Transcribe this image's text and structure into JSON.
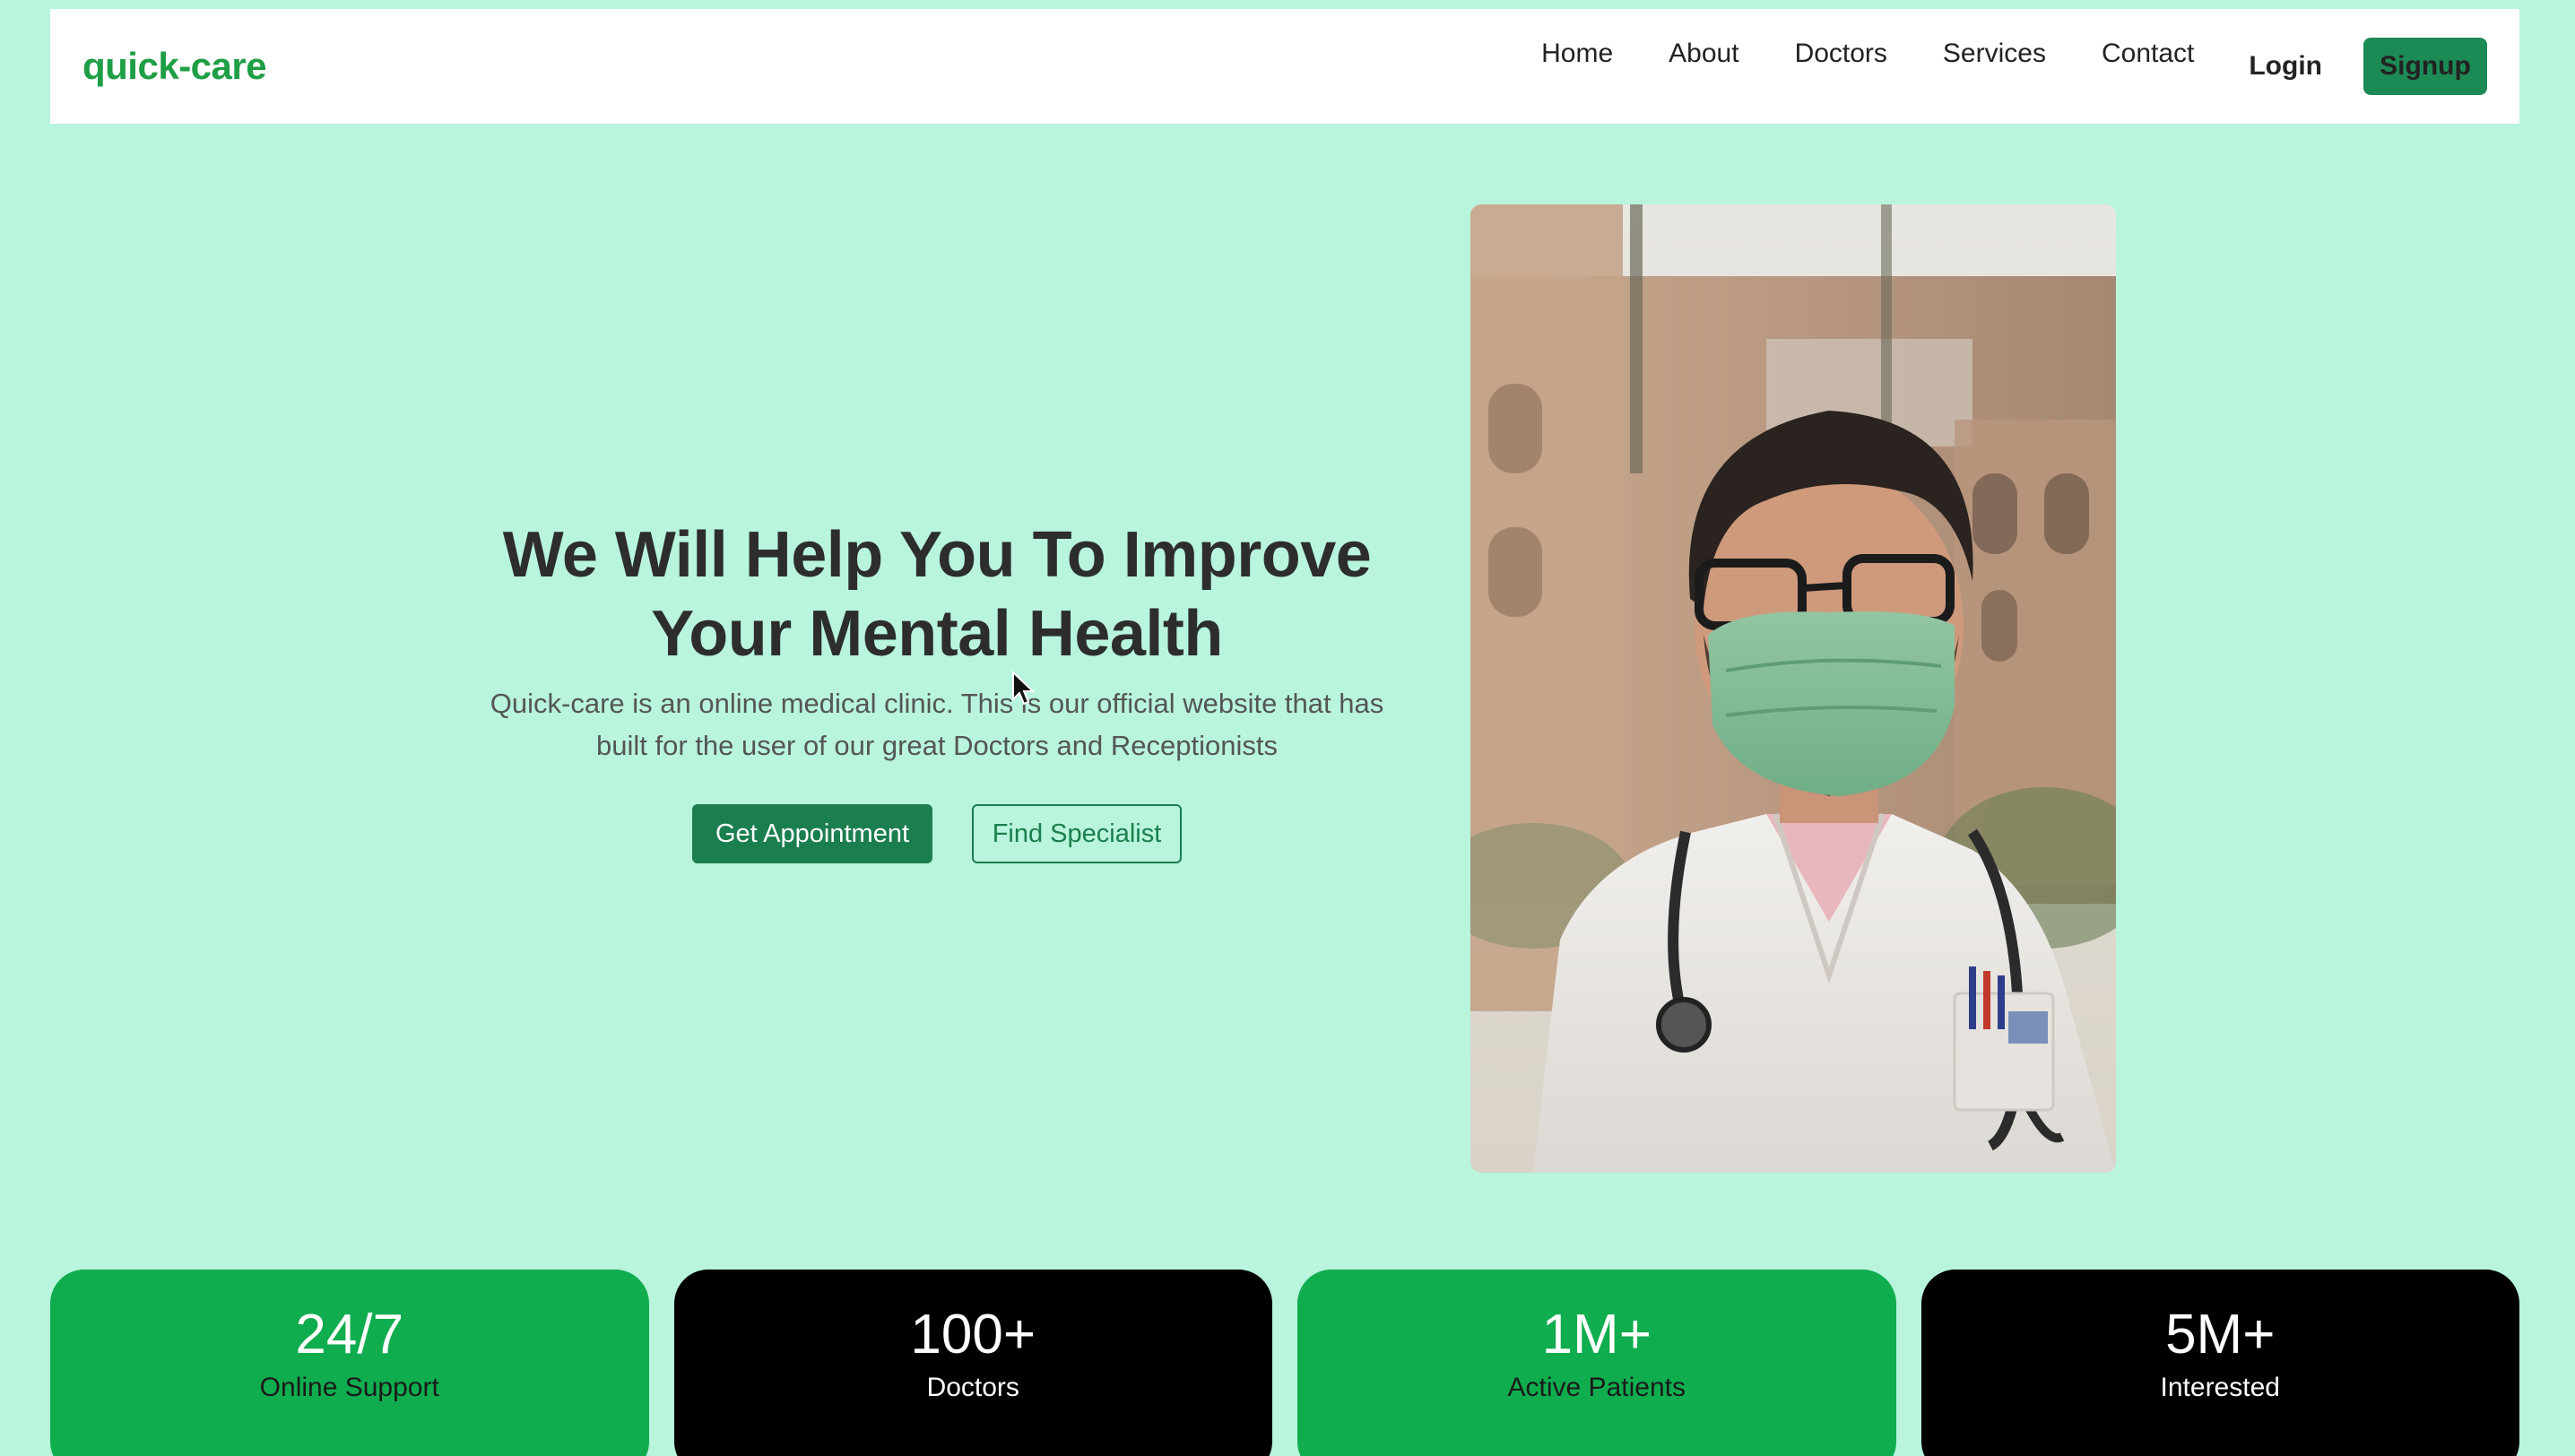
{
  "navbar": {
    "brand": "quick-care",
    "links": [
      "Home",
      "About",
      "Doctors",
      "Services",
      "Contact"
    ],
    "login_label": "Login",
    "signup_label": "Signup"
  },
  "hero": {
    "title_line1": "We Will Help You To Improve",
    "title_line2": "Your Mental Health",
    "description_line1": "Quick-care is an online medical clinic. This is our official website that has",
    "description_line2": "built for the user of our great Doctors and Receptionists",
    "primary_button": "Get Appointment",
    "secondary_button": "Find Specialist"
  },
  "stats": [
    {
      "value": "24/7",
      "label": "Online Support",
      "color": "#10ad4e"
    },
    {
      "value": "100+",
      "label": "Doctors",
      "color": "#000000"
    },
    {
      "value": "1M+",
      "label": "Active Patients",
      "color": "#10ad4e"
    },
    {
      "value": "5M+",
      "label": "Interested",
      "color": "#000000"
    }
  ],
  "colors": {
    "page_background": "#b8f5dc",
    "brand": "#1e9e45",
    "primary": "#1b7e4e"
  }
}
